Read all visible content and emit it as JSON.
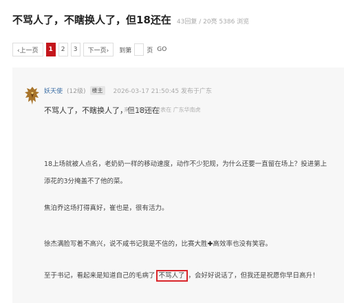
{
  "thread": {
    "title": "不骂人了，不瞎换人了，但18还在",
    "stats": "43回复 / 20亮 5386 浏览"
  },
  "pager": {
    "prev": "‹上一页",
    "pages": [
      "1",
      "2",
      "3"
    ],
    "current_page": "1",
    "next": "下一页›",
    "jump_label": "到第",
    "page_unit": "页",
    "go": "GO"
  },
  "post": {
    "author": "妖天使",
    "level": "(12级)",
    "owner_badge": "楼主",
    "time": "2026-03-17 21:50:45  发布于广东",
    "title": "不骂人了，不瞎换人了，但18还在",
    "source": "来自 妖天使 发表在 广东华南虎",
    "paragraphs": {
      "p1": "18上场就被人点名，老奶奶一样的移动速度，动作不少犯规，为什么还要一直留在场上？投进第上添花的3分掩盖不了他的菜。",
      "p2": "焦泊乔这场打得真好，崔也是，很有活力。",
      "p3a": "徐杰满脸写着不高兴，说不咸书记我是不信的，比赛大胜",
      "p3_symbol": "✚",
      "p3b": "高效率也没有笑容。",
      "p4a": "至于书记，看起来是知道自己的毛病了",
      "p4_highlight": "不骂人了",
      "p4b": "，会好好说话了，但我还是祝愿你早日高升！"
    }
  },
  "colors": {
    "accent": "#c4161c",
    "highlight_box": "#d9252a",
    "author_link": "#3b6ea5"
  }
}
